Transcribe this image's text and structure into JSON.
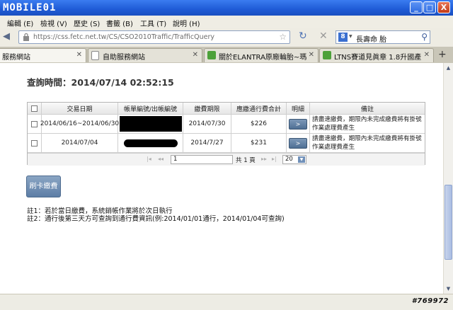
{
  "window": {
    "logo_text": "MOBILE01",
    "min_label": "_",
    "max_label": "□",
    "close_label": "X"
  },
  "menu": {
    "items": [
      "編輯 (E)",
      "檢視 (V)",
      "歷史 (S)",
      "書籤 (B)",
      "工具 (T)",
      "說明 (H)"
    ]
  },
  "nav": {
    "url": "https://css.fetc.net.tw/CS/CSO2010Traffic/TrafficQuery",
    "search_text": "長壽命 胎"
  },
  "tabs": [
    {
      "title": "服務網站",
      "active": true
    },
    {
      "title": "自助服務網站",
      "active": false
    },
    {
      "title": "關於ELANTRA原廠輪胎~瑪...",
      "active": false
    },
    {
      "title": "LTNS賽道見眞章 1.8升國產...",
      "active": false
    }
  ],
  "page": {
    "query_time": "查詢時間：2014/07/14 02:52:15",
    "table": {
      "columns": [
        "",
        "交易日期",
        "帳單編號/出帳編號",
        "繳費期限",
        "應繳通行費合計",
        "明細",
        "備註"
      ],
      "rows": [
        {
          "date": "2014/06/16~2014/06/30",
          "deadline": "2014/07/30",
          "amount": "$226",
          "note": "請盡速繳費，期限內未完成繳費將有掛號作業處理費產生"
        },
        {
          "date": "2014/07/04",
          "deadline": "2014/7/27",
          "amount": "$231",
          "note": "請盡速繳費，期限內未完成繳費將有掛號作業處理費產生"
        }
      ],
      "detail_label": ">",
      "pager": {
        "page": "1",
        "total": "共 1 頁",
        "page_size": "20"
      }
    },
    "pay_button": "刷卡繳費",
    "note1": "註1：若於當日繳費，系統銷帳作業將於次日執行",
    "note2": "註2：通行後第三天方可查詢到通行費資訊(例:2014/01/01通行，2014/01/04可查詢)"
  },
  "watermark": "#769972"
}
